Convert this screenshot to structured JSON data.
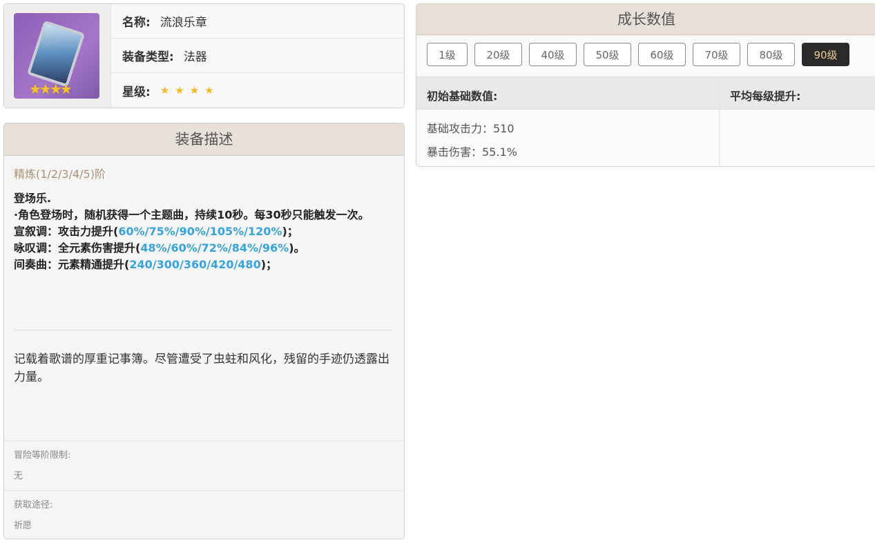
{
  "info": {
    "name_label": "名称:",
    "name": "流浪乐章",
    "type_label": "装备类型:",
    "type": "法器",
    "rarity_label": "星级:",
    "rarity": 4,
    "icon_stars": "★★★★"
  },
  "description": {
    "title": "装备描述",
    "refinement": "精炼(1/2/3/4/5)阶",
    "passive_name": "登场乐.",
    "passive_text": "·角色登场时，随机获得一个主题曲，持续10秒。每30秒只能触发一次。",
    "effects": [
      {
        "prefix": "宣叙调：攻击力提升(",
        "values": "60%/75%/90%/105%/120%",
        "suffix": ")；"
      },
      {
        "prefix": "咏叹调：全元素伤害提升(",
        "values": "48%/60%/72%/84%/96%",
        "suffix": ")。"
      },
      {
        "prefix": "间奏曲：元素精通提升(",
        "values": "240/300/360/420/480",
        "suffix": ")；"
      }
    ],
    "lore": "记载着歌谱的厚重记事簿。尽管遭受了虫蛀和风化，残留的手迹仍透露出力量。",
    "ar_label": "冒险等阶限制:",
    "ar_value": "无",
    "source_label": "获取途径:",
    "source_value": "祈愿"
  },
  "growth": {
    "title": "成长数值",
    "levels": [
      "1级",
      "20级",
      "40级",
      "50级",
      "60级",
      "70级",
      "80级",
      "90级"
    ],
    "selected": "90级",
    "base_label": "初始基础数值:",
    "avg_label": "平均每级提升:",
    "stats": [
      "基础攻击力：510",
      "暴击伤害：55.1%"
    ]
  },
  "colors": {
    "accent_blue": "#39a2d6",
    "star": "#f4b824",
    "selected_btn": "#2b2a28"
  }
}
